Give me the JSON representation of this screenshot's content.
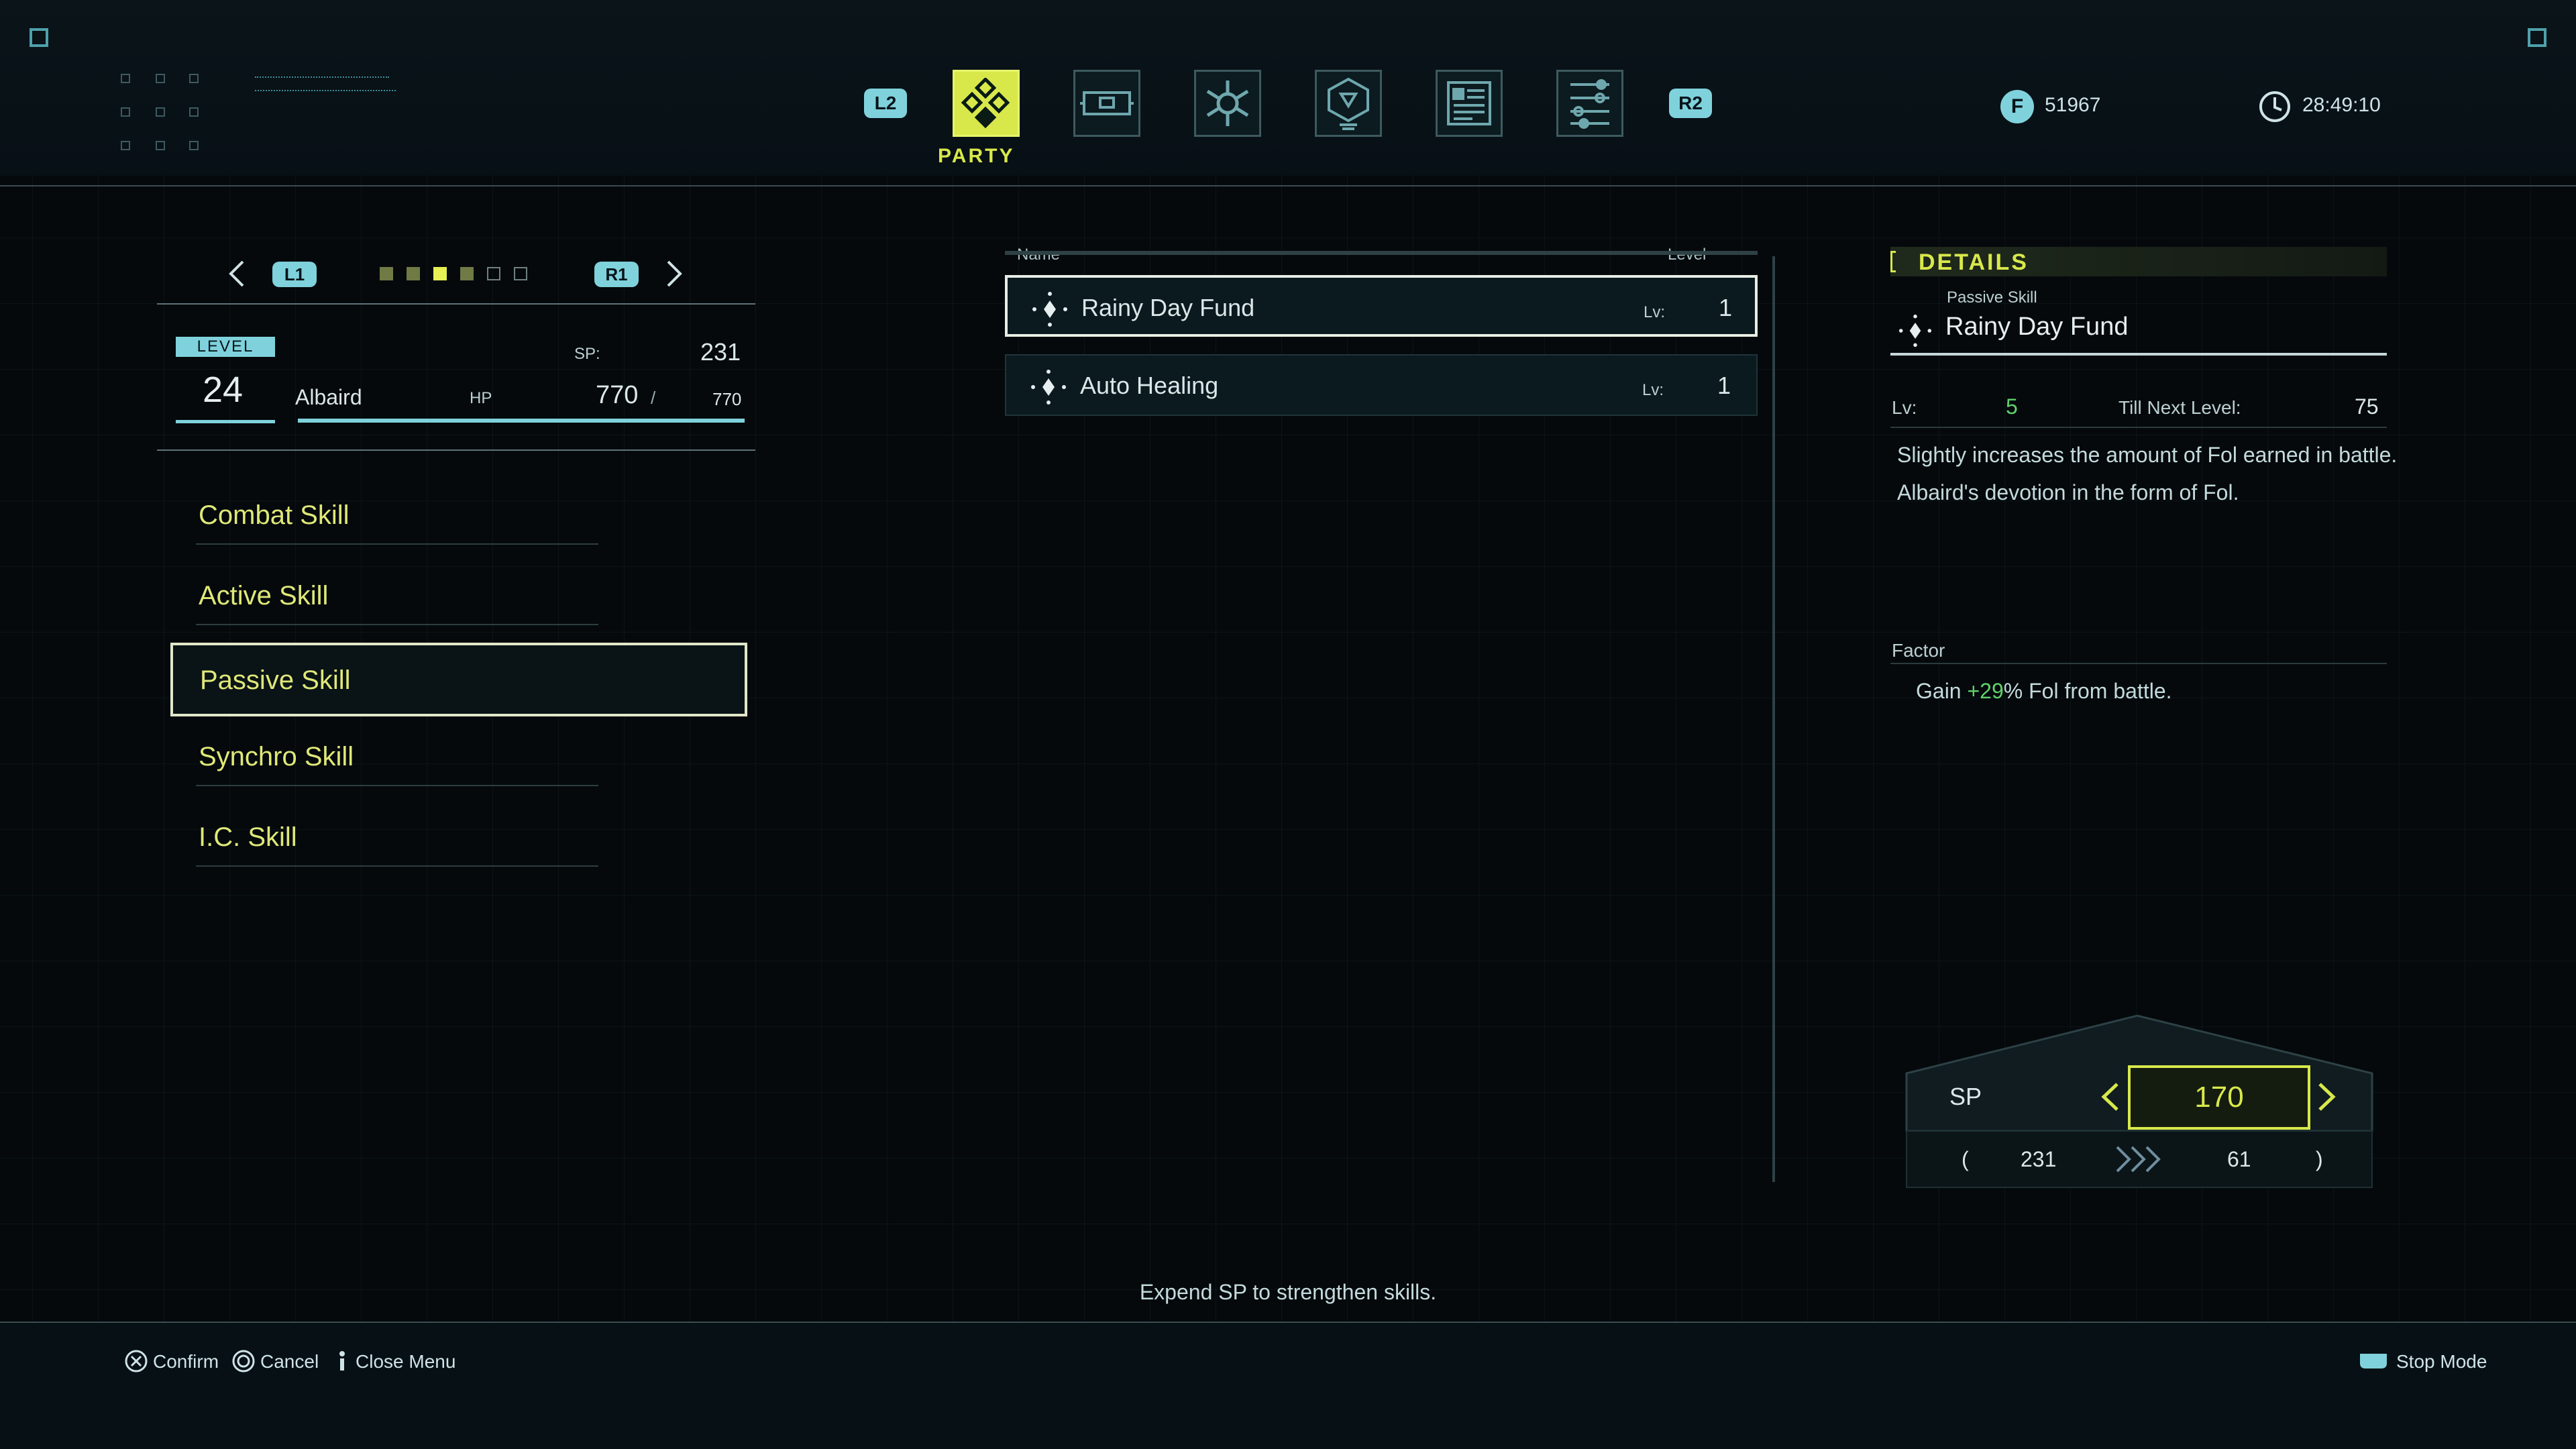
{
  "top_menu": {
    "l2_label": "L2",
    "r2_label": "R2",
    "tabs": [
      {
        "icon": "party-icon",
        "label": "PARTY",
        "active": true
      },
      {
        "icon": "items-icon"
      },
      {
        "icon": "skills-icon"
      },
      {
        "icon": "ability-icon"
      },
      {
        "icon": "notes-icon"
      },
      {
        "icon": "settings-icon"
      }
    ],
    "active_label": "PARTY",
    "fol": "51967",
    "playtime": "28:49:10"
  },
  "character": {
    "l1_label": "L1",
    "r1_label": "R1",
    "level_label": "LEVEL",
    "level": "24",
    "name": "Albaird",
    "sp_label": "SP:",
    "sp": "231",
    "hp_label": "HP",
    "hp_current": "770",
    "hp_sep": "/",
    "hp_max": "770",
    "party_slots": 6,
    "selected_slot": 3
  },
  "categories": [
    {
      "label": "Combat Skill"
    },
    {
      "label": "Active Skill"
    },
    {
      "label": "Passive Skill",
      "selected": true
    },
    {
      "label": "Synchro Skill"
    },
    {
      "label": "I.C. Skill"
    }
  ],
  "skill_list": {
    "col_name": "Name",
    "col_level": "Level",
    "rows": [
      {
        "name": "Rainy Day Fund",
        "lv_label": "Lv:",
        "level": "1",
        "selected": true
      },
      {
        "name": "Auto Healing",
        "lv_label": "Lv:",
        "level": "1",
        "selected": false
      }
    ]
  },
  "details": {
    "title": "DETAILS",
    "type": "Passive Skill",
    "name": "Rainy Day Fund",
    "lv_label": "Lv:",
    "lv_value": "5",
    "next_label": "Till Next Level:",
    "next_value": "75",
    "desc_line1": "Slightly increases the amount of Fol earned in battle.",
    "desc_line2": "Albaird's devotion in the form of Fol.",
    "factor_title": "Factor",
    "factor_pre": "Gain ",
    "factor_value": "+29",
    "factor_post": "% Fol from battle."
  },
  "sp_spend": {
    "label": "SP",
    "amount": "170",
    "open_paren": "(",
    "from": "231",
    "to": "61",
    "close_paren": ")"
  },
  "hint": "Expend SP to strengthen skills.",
  "controls": {
    "confirm": "Confirm",
    "cancel": "Cancel",
    "close_menu": "Close Menu",
    "stop_mode": "Stop Mode"
  },
  "colors": {
    "accent_yellow": "#d8e84a",
    "accent_cyan": "#7fd2dc",
    "bonus_green": "#5fd36a"
  }
}
